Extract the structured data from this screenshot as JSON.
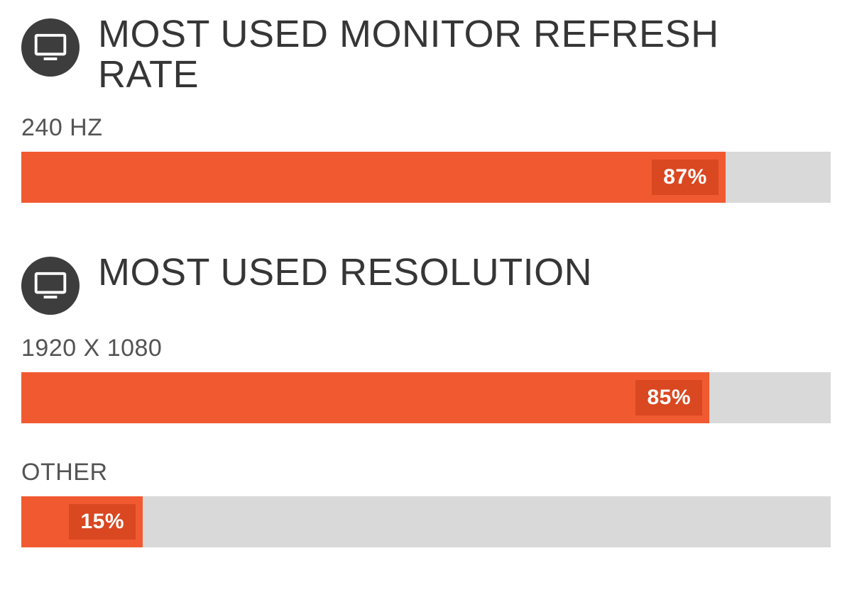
{
  "sections": [
    {
      "title": "MOST USED MONITOR REFRESH RATE",
      "bars": [
        {
          "label": "240 HZ",
          "value": 87,
          "value_label": "87%"
        }
      ]
    },
    {
      "title": "MOST USED RESOLUTION",
      "bars": [
        {
          "label": "1920 X 1080",
          "value": 85,
          "value_label": "85%"
        },
        {
          "label": "OTHER",
          "value": 15,
          "value_label": "15%"
        }
      ]
    }
  ],
  "colors": {
    "bar_fill": "#f15a31",
    "bar_value_bg": "#d94821",
    "track": "#d9d9d9",
    "icon_bg": "#3d3d3d"
  },
  "chart_data": [
    {
      "type": "bar",
      "title": "MOST USED MONITOR REFRESH RATE",
      "categories": [
        "240 HZ"
      ],
      "values": [
        87
      ],
      "xlabel": "",
      "ylabel": "",
      "ylim": [
        0,
        100
      ]
    },
    {
      "type": "bar",
      "title": "MOST USED RESOLUTION",
      "categories": [
        "1920 X 1080",
        "OTHER"
      ],
      "values": [
        85,
        15
      ],
      "xlabel": "",
      "ylabel": "",
      "ylim": [
        0,
        100
      ]
    }
  ]
}
